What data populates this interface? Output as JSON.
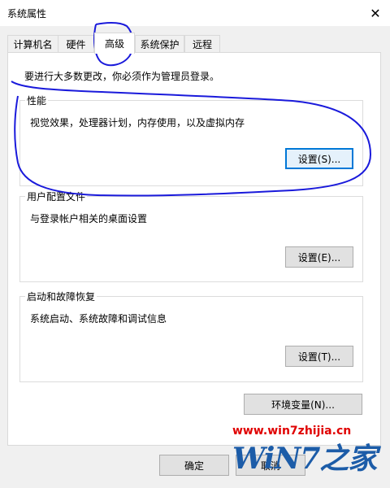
{
  "window": {
    "title": "系统属性"
  },
  "tabs": [
    {
      "label": "计算机名",
      "active": false
    },
    {
      "label": "硬件",
      "active": false
    },
    {
      "label": "高级",
      "active": true
    },
    {
      "label": "系统保护",
      "active": false
    },
    {
      "label": "远程",
      "active": false
    }
  ],
  "panel": {
    "note": "要进行大多数更改，你必须作为管理员登录。",
    "performance": {
      "title": "性能",
      "description": "视觉效果，处理器计划，内存使用，以及虚拟内存",
      "button": "设置(S)..."
    },
    "profile": {
      "title": "用户配置文件",
      "description": "与登录帐户相关的桌面设置",
      "button": "设置(E)..."
    },
    "startup": {
      "title": "启动和故障恢复",
      "description": "系统启动、系统故障和调试信息",
      "button": "设置(T)..."
    },
    "env_button": "环境变量(N)..."
  },
  "footer": {
    "ok": "确定",
    "cancel": "取消"
  },
  "watermark": {
    "url": "www.win7zhijia.cn",
    "logo": "WiN7之家"
  },
  "colors": {
    "annotation": "#1a1adb",
    "focus": "#0078d7",
    "watermark_url": "#e00000",
    "logo": "#1c5ca8"
  }
}
